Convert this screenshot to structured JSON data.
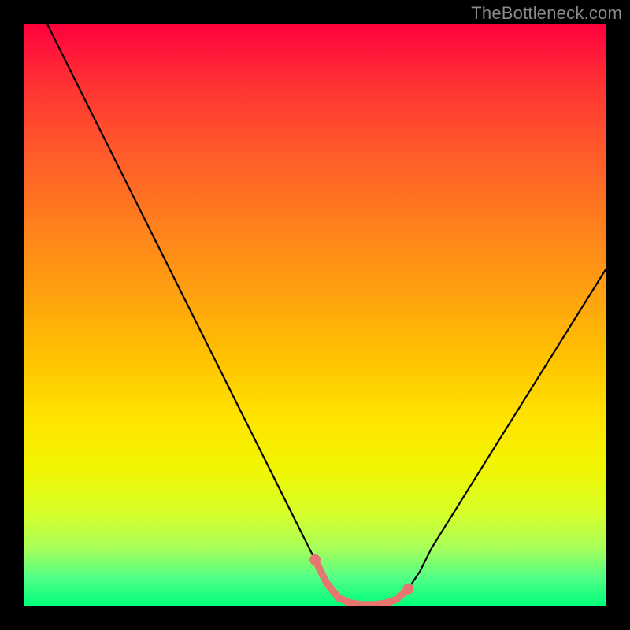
{
  "watermark": "TheBottleneck.com",
  "chart_data": {
    "type": "line",
    "title": "",
    "xlabel": "",
    "ylabel": "",
    "xlim": [
      0,
      100
    ],
    "ylim": [
      0,
      100
    ],
    "x": [
      0,
      5,
      10,
      15,
      20,
      25,
      30,
      35,
      40,
      45,
      50,
      52,
      54,
      56,
      58,
      60,
      62,
      64,
      66,
      68,
      70,
      75,
      80,
      85,
      90,
      95,
      100
    ],
    "series": [
      {
        "name": "bottleneck-curve",
        "values": [
          108,
          98,
          88,
          78,
          68,
          58,
          48,
          38,
          28,
          18,
          8,
          4,
          1.5,
          0.6,
          0.3,
          0.3,
          0.5,
          1.2,
          3,
          6,
          10,
          18,
          26,
          34,
          42,
          50,
          58
        ]
      }
    ],
    "markers": {
      "name": "optimal-range",
      "color": "#e77570",
      "x": [
        50,
        52,
        54,
        56,
        58,
        60,
        62,
        64,
        66
      ],
      "values": [
        8,
        4,
        1.5,
        0.6,
        0.3,
        0.3,
        0.5,
        1.2,
        3
      ]
    },
    "background": {
      "type": "vertical-gradient",
      "stops": [
        {
          "pos": 0,
          "color": "#ff003a"
        },
        {
          "pos": 50,
          "color": "#ffc400"
        },
        {
          "pos": 100,
          "color": "#00ff7a"
        }
      ]
    }
  }
}
